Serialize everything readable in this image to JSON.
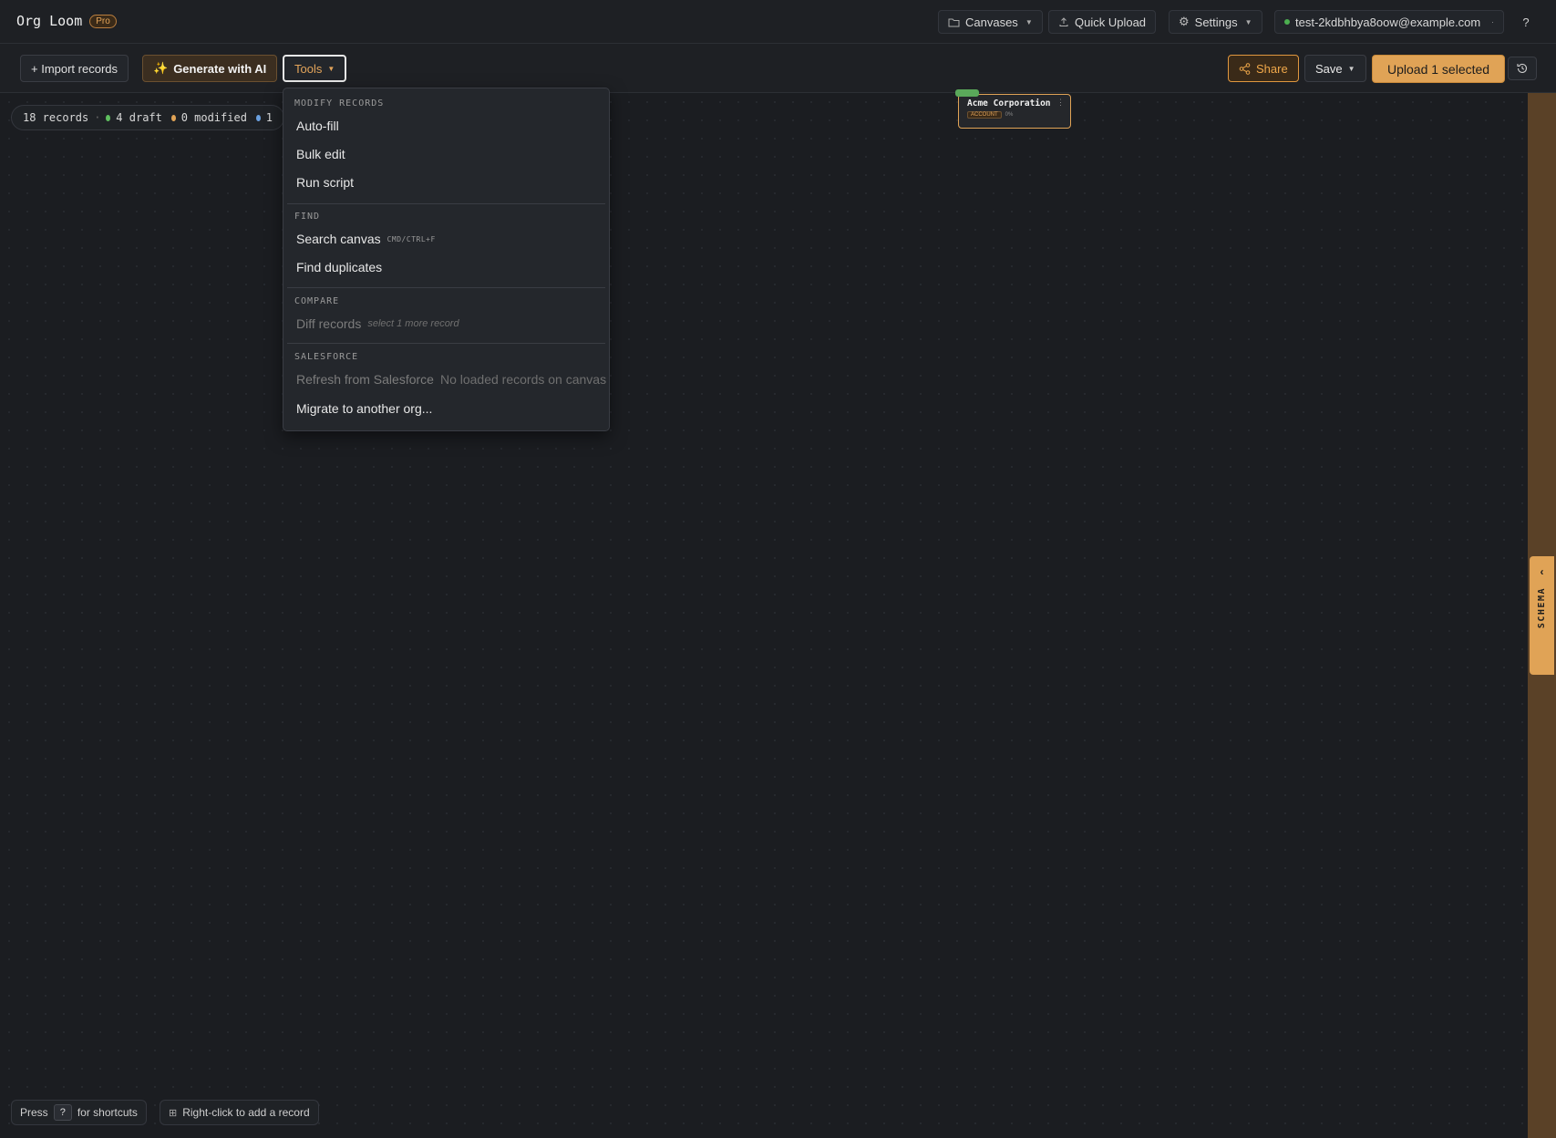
{
  "app": {
    "name": "Org Loom",
    "plan_badge": "Pro"
  },
  "topbar": {
    "canvases_label": "Canvases",
    "quick_upload_label": "Quick Upload",
    "settings_label": "Settings",
    "account_email": "test-2kdbhbya8oow@example.com",
    "account_status_color": "#4caf50",
    "help_label": "?"
  },
  "toolbar": {
    "import_label": "+ Import records",
    "generate_label": "Generate with AI",
    "tools_label": "Tools",
    "share_label": "Share",
    "save_label": "Save",
    "upload_label": "Upload 1 selected"
  },
  "stats": {
    "records": "18 records",
    "separator": "·",
    "draft": "4 draft",
    "modified": "0 modified",
    "third": "1",
    "draft_color": "#5fbf5f",
    "modified_color": "#e0a356",
    "third_color": "#6aa0e0"
  },
  "record_card": {
    "title": "Acme Corporation",
    "type": "ACCOUNT",
    "percent": "0%"
  },
  "tools_menu": {
    "sections": [
      {
        "label": "MODIFY RECORDS",
        "items": [
          {
            "label": "Auto-fill"
          },
          {
            "label": "Bulk edit"
          },
          {
            "label": "Run script"
          }
        ]
      },
      {
        "label": "FIND",
        "items": [
          {
            "label": "Search canvas",
            "shortcut": "CMD/CTRL+F"
          },
          {
            "label": "Find duplicates"
          }
        ]
      },
      {
        "label": "COMPARE",
        "items": [
          {
            "label": "Diff records",
            "hint": "select 1 more record",
            "disabled": true
          }
        ]
      },
      {
        "label": "SALESFORCE",
        "items": [
          {
            "label": "Refresh from Salesforce",
            "hint": "No loaded records on canvas",
            "disabled": true
          },
          {
            "label": "Migrate to another org..."
          }
        ]
      }
    ]
  },
  "schema_tab": {
    "label": "SCHEMA"
  },
  "bottom_hints": {
    "press": "Press",
    "key": "?",
    "for_shortcuts": "for shortcuts",
    "add_record": "Right-click to add a record"
  },
  "colors": {
    "accent": "#e0a356",
    "background": "#1b1d21"
  }
}
